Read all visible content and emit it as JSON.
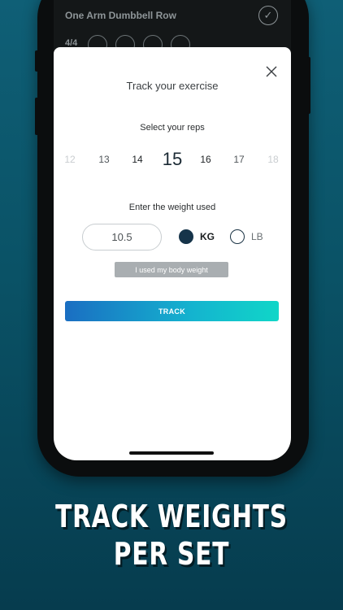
{
  "background_screen": {
    "exercise_title": "One Arm Dumbbell Row",
    "set_count": "4/4"
  },
  "modal": {
    "title": "Track your exercise",
    "reps_label": "Select your reps",
    "reps": [
      {
        "value": "12",
        "state": "faded"
      },
      {
        "value": "13",
        "state": "normal"
      },
      {
        "value": "14",
        "state": "near"
      },
      {
        "value": "15",
        "state": "selected"
      },
      {
        "value": "16",
        "state": "near"
      },
      {
        "value": "17",
        "state": "normal"
      },
      {
        "value": "18",
        "state": "faded"
      }
    ],
    "weight_label": "Enter the weight used",
    "weight_value": "10.5",
    "units": [
      {
        "label": "KG",
        "selected": true
      },
      {
        "label": "LB",
        "selected": false
      }
    ],
    "bodyweight_label": "I used my body weight",
    "track_label": "TRACK"
  },
  "headline": {
    "line1": "TRACK WEIGHTS",
    "line2": "PER SET"
  },
  "icons": {
    "close": "close-icon",
    "check": "check-icon"
  },
  "colors": {
    "accent_start": "#1a6ec2",
    "accent_end": "#10d6c8",
    "radio_selected": "#16344a",
    "background": "#0a5266"
  }
}
